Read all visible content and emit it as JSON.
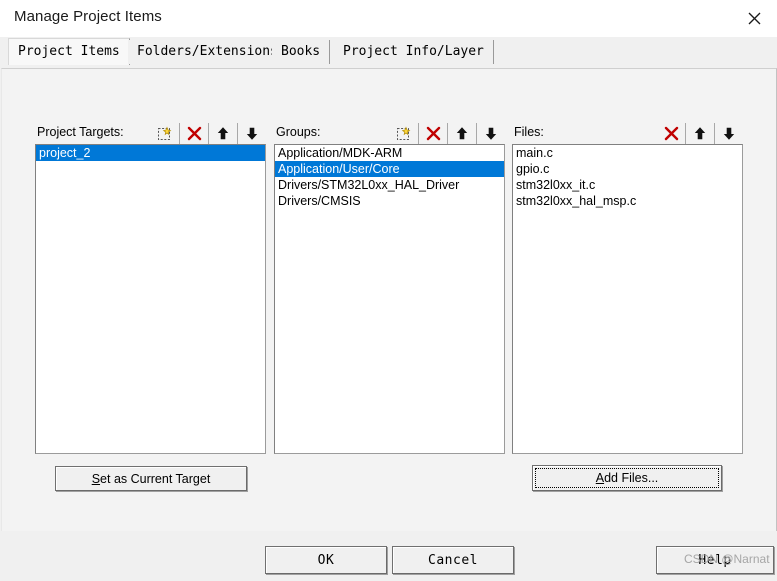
{
  "window": {
    "title": "Manage Project Items",
    "close_icon": "close-icon"
  },
  "tabs": [
    {
      "label": "Project Items",
      "active": true
    },
    {
      "label": "Folders/Extensions",
      "active": false
    },
    {
      "label": "Books",
      "active": false
    },
    {
      "label": "Project Info/Layer",
      "active": false
    }
  ],
  "panels": {
    "targets": {
      "label": "Project Targets:",
      "icons": [
        "new-item-icon",
        "delete-icon",
        "move-up-icon",
        "move-down-icon"
      ],
      "items": [
        {
          "label": "project_2",
          "selected": true
        }
      ]
    },
    "groups": {
      "label": "Groups:",
      "icons": [
        "new-item-icon",
        "delete-icon",
        "move-up-icon",
        "move-down-icon"
      ],
      "items": [
        {
          "label": "Application/MDK-ARM",
          "selected": false
        },
        {
          "label": "Application/User/Core",
          "selected": true
        },
        {
          "label": "Drivers/STM32L0xx_HAL_Driver",
          "selected": false
        },
        {
          "label": "Drivers/CMSIS",
          "selected": false
        }
      ]
    },
    "files": {
      "label": "Files:",
      "icons": [
        "delete-icon",
        "move-up-icon",
        "move-down-icon"
      ],
      "items": [
        {
          "label": "main.c",
          "selected": false
        },
        {
          "label": "gpio.c",
          "selected": false
        },
        {
          "label": "stm32l0xx_it.c",
          "selected": false
        },
        {
          "label": "stm32l0xx_hal_msp.c",
          "selected": false
        }
      ]
    }
  },
  "buttons": {
    "set_current_target": {
      "prefix": "",
      "accel": "S",
      "rest": "et as Current Target"
    },
    "add_files": {
      "prefix": "",
      "accel": "A",
      "rest": "dd Files..."
    },
    "ok": "OK",
    "cancel": "Cancel",
    "help": "Help"
  },
  "watermark": "CSDN @Narnat",
  "colors": {
    "selection_blue": "#0078d7",
    "dialog_bg": "#f0f0f0",
    "page_bg": "#f3f3f3",
    "delete_red": "#c00000"
  }
}
